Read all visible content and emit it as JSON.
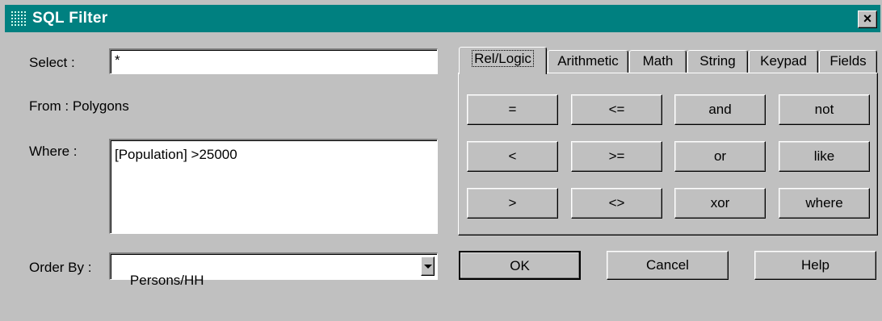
{
  "window": {
    "title": "SQL Filter",
    "close_label": "×"
  },
  "select": {
    "label": "Select :",
    "value": "*"
  },
  "from": {
    "label": "From  : Polygons"
  },
  "where": {
    "label": "Where :",
    "value": "[Population] >25000"
  },
  "order_by": {
    "label": "Order By :",
    "value": "Persons/HH"
  },
  "tabs": [
    {
      "label": "Rel/Logic",
      "active": true
    },
    {
      "label": "Arithmetic"
    },
    {
      "label": "Math"
    },
    {
      "label": "String"
    },
    {
      "label": "Keypad"
    },
    {
      "label": "Fields"
    }
  ],
  "operators": [
    [
      "=",
      "<=",
      "and",
      "not"
    ],
    [
      "<",
      ">=",
      "or",
      "like"
    ],
    [
      ">",
      "<>",
      "xor",
      "where"
    ]
  ],
  "actions": {
    "ok": "OK",
    "cancel": "Cancel",
    "help": "Help"
  },
  "colors": {
    "titlebar": "#008080",
    "face": "#c0c0c0"
  }
}
